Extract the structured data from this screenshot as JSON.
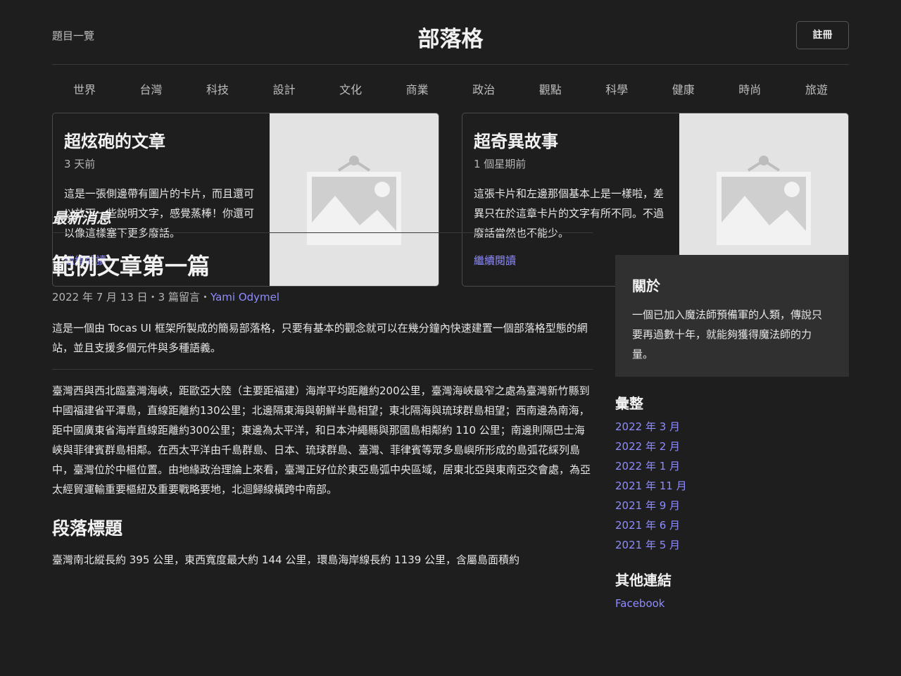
{
  "header": {
    "left_link": "題目一覽",
    "site_title": "部落格",
    "register_label": "註冊"
  },
  "nav": [
    "世界",
    "台灣",
    "科技",
    "設計",
    "文化",
    "商業",
    "政治",
    "觀點",
    "科學",
    "健康",
    "時尚",
    "旅遊"
  ],
  "cards": [
    {
      "title": "超炫砲的文章",
      "meta": "3 天前",
      "desc": "這是一張側邊帶有圖片的卡片，而且還可以放下一些說明文字，感覺蒸棒！你還可以像這樣塞下更多廢話。",
      "link": "繼續閱讀"
    },
    {
      "title": "超奇異故事",
      "meta": "1 個星期前",
      "desc": "這張卡片和左邊那個基本上是一樣啦，差異只在於這章卡片的文字有所不同。不過廢話當然也不能少。",
      "link": "繼續閱讀"
    }
  ],
  "main": {
    "section_label": "最新消息",
    "post_title": "範例文章第一篇",
    "post_date": "2022 年 7 月 13 日",
    "post_comments": "3 篇留言",
    "post_author": "Yami Odymel",
    "post_intro": "這是一個由 Tocas UI 框架所製成的簡易部落格，只要有基本的觀念就可以在幾分鐘內快速建置一個部落格型態的網站，並且支援多個元件與多種語義。",
    "post_para": "臺灣西與西北臨臺灣海峽，距歐亞大陸（主要距福建）海岸平均距離約200公里，臺灣海峽最窄之處為臺灣新竹縣到中國福建省平潭島，直線距離約130公里；北邊隔東海與朝鮮半島相望；東北隔海與琉球群島相望；西南邊為南海，距中國廣東省海岸直線距離約300公里；東邊為太平洋，和日本沖繩縣與那國島相鄰約 110 公里；南邊則隔巴士海峽與菲律賓群島相鄰。在西太平洋由千島群島、日本、琉球群島、臺灣、菲律賓等眾多島嶼所形成的島弧花綵列島中，臺灣位於中樞位置。由地緣政治理論上來看，臺灣正好位於東亞島弧中央區域，居東北亞與東南亞交會處，為亞太經貿運輸重要樞紐及重要戰略要地，北迴歸線橫跨中南部。",
    "post_subhead": "段落標題",
    "post_para2": "臺灣南北縱長約 395 公里，東西寬度最大約 144 公里，環島海岸線長約 1139 公里，含屬島面積約"
  },
  "sidebar": {
    "about_title": "關於",
    "about_text": "一個已加入魔法師預備軍的人類，傳說只要再過數十年，就能夠獲得魔法師的力量。",
    "archive_title": "彙整",
    "archive": [
      "2022 年 3 月",
      "2022 年 2 月",
      "2022 年 1 月",
      "2021 年 11 月",
      "2021 年 9 月",
      "2021 年 6 月",
      "2021 年 5 月"
    ],
    "links_title": "其他連結",
    "links": [
      "Facebook"
    ]
  }
}
